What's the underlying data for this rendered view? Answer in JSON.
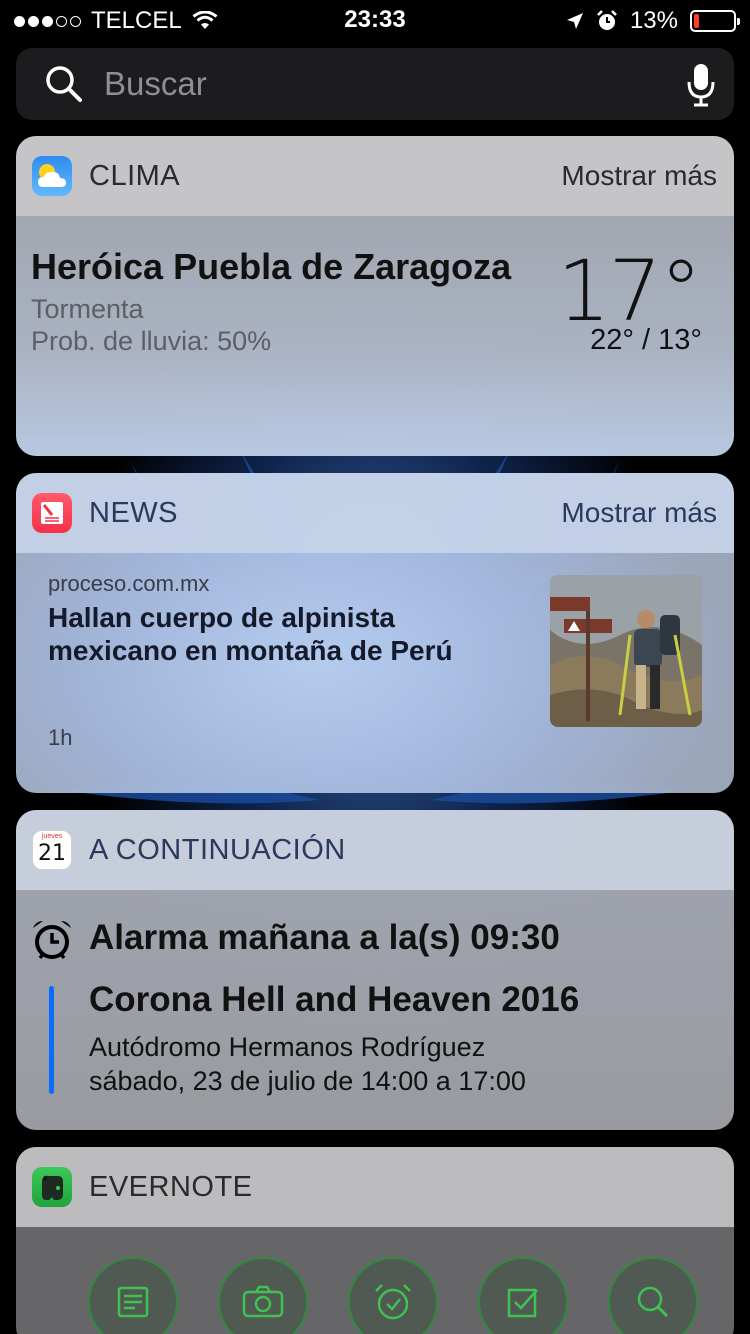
{
  "status_bar": {
    "carrier": "TELCEL",
    "time": "23:33",
    "battery_percent": "13%",
    "battery_level": 0.13,
    "icons": [
      "signal-dots-icon",
      "wifi-icon",
      "location-arrow-icon",
      "alarm-clock-icon",
      "battery-icon"
    ]
  },
  "search": {
    "placeholder": "Buscar",
    "icons": [
      "search-icon",
      "microphone-icon"
    ]
  },
  "weather_widget": {
    "title": "CLIMA",
    "more_label": "Mostrar más",
    "city": "Heróica Puebla de Zaragoza",
    "condition": "Tormenta",
    "rain_probability": "Prob. de lluvia: 50%",
    "temperature": "17°",
    "high_low": "22° / 13°",
    "icon": "weather-cloud-sun-icon"
  },
  "news_widget": {
    "title": "NEWS",
    "more_label": "Mostrar más",
    "source": "proceso.com.mx",
    "headline": "Hallan cuerpo de alpinista mexicano en montaña de Perú",
    "age": "1h",
    "icon": "news-icon"
  },
  "upnext_widget": {
    "title": "A CONTINUACIÓN",
    "calendar_icon_day": "jueves",
    "calendar_icon_date": "21",
    "alarm_text": "Alarma mañana a la(s) 09:30",
    "event": {
      "title": "Corona Hell and Heaven 2016",
      "location": "Autódromo Hermanos Rodríguez",
      "when": "sábado, 23 de julio de 14:00 a 17:00"
    },
    "accent_color": "#0a6cff"
  },
  "evernote_widget": {
    "title": "EVERNOTE",
    "icon": "evernote-elephant-icon",
    "actions": [
      "new-text-note-icon",
      "camera-icon",
      "reminder-alarm-icon",
      "checklist-icon",
      "search-icon"
    ],
    "accent_color": "#2e8b3e"
  }
}
